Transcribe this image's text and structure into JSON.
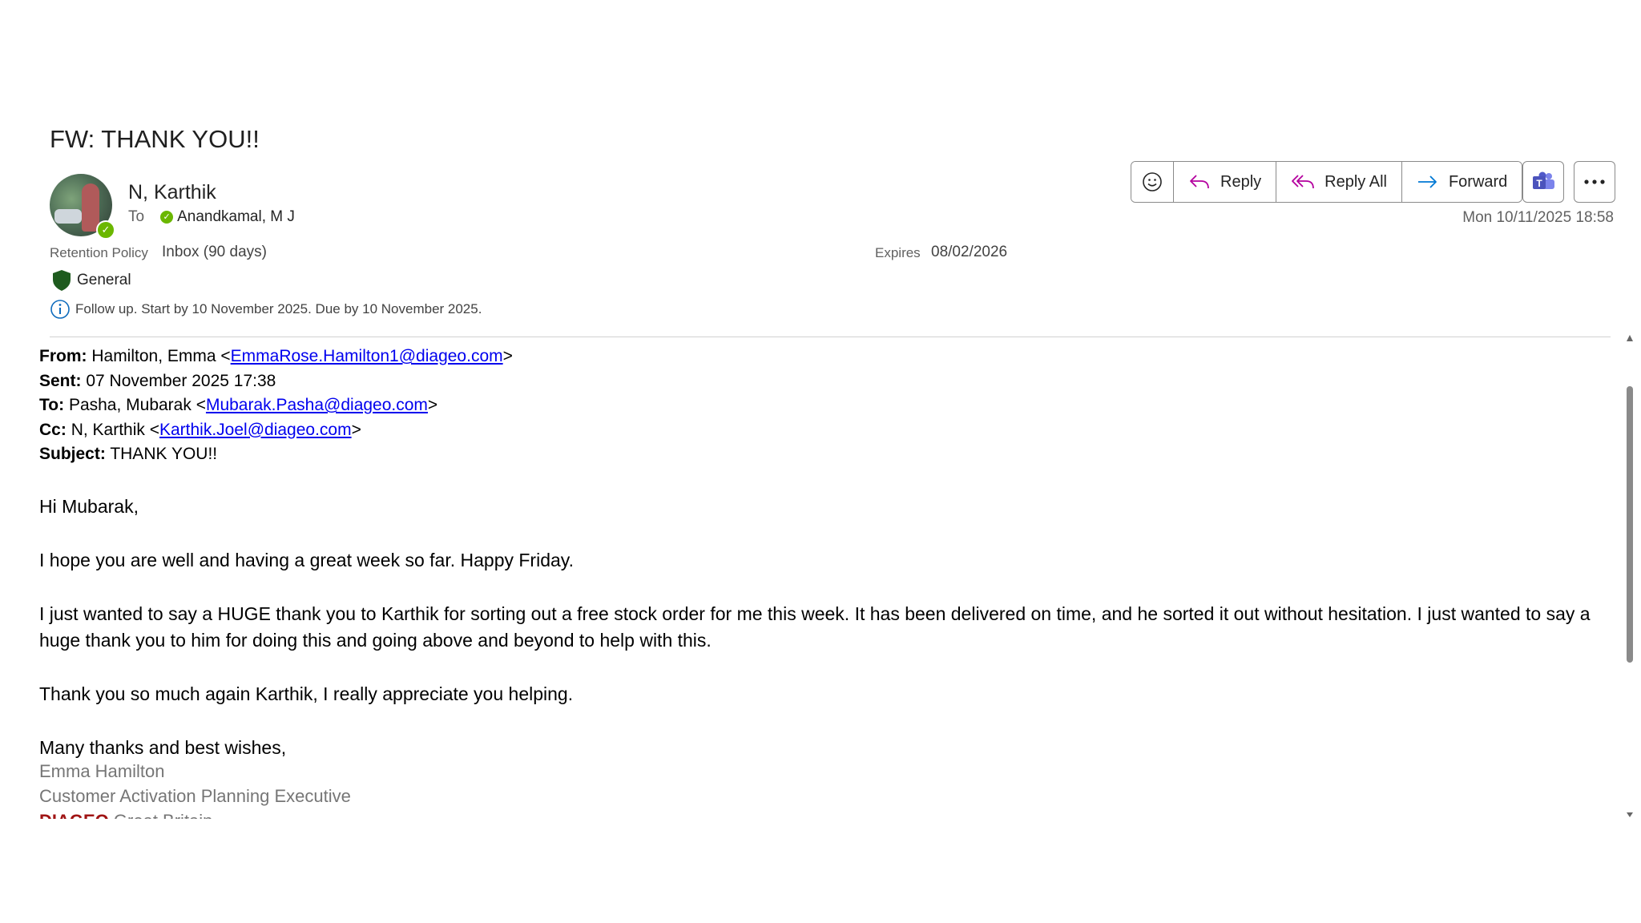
{
  "message": {
    "subject": "FW: THANK YOU!!",
    "sender": "N, Karthik",
    "to_label": "To",
    "recipient": "Anandkamal, M J",
    "date": "Mon 10/11/2025 18:58"
  },
  "retention": {
    "label": "Retention Policy",
    "value": "Inbox (90 days)",
    "expires_label": "Expires",
    "expires_value": "08/02/2026"
  },
  "sensitivity": {
    "label": "General"
  },
  "follow_up": {
    "text": "Follow up.  Start by 10 November 2025.  Due by 10 November 2025."
  },
  "toolbar": {
    "reply": "Reply",
    "reply_all": "Reply All",
    "forward": "Forward",
    "icons": [
      "smiley-icon",
      "reply-icon",
      "reply-all-icon",
      "forward-icon",
      "teams-icon",
      "more-icon"
    ]
  },
  "forwarded": {
    "from_label": "From:",
    "from_name": "Hamilton, Emma <",
    "from_email": "EmmaRose.Hamilton1@diageo.com",
    "sent_label": "Sent:",
    "sent_value": "07 November 2025 17:38",
    "to_label": "To:",
    "to_name": "Pasha, Mubarak <",
    "to_email": "Mubarak.Pasha@diageo.com",
    "cc_label": "Cc:",
    "cc_name": "N, Karthik <",
    "cc_email": "Karthik.Joel@diageo.com",
    "subject_label": "Subject:",
    "subject_value": "THANK YOU!!",
    "close_bracket": ">"
  },
  "body": {
    "greeting": "Hi Mubarak,",
    "p1": "I hope you are well and having a great week so far. Happy Friday.",
    "p2": "I just wanted to say a HUGE thank you to Karthik for sorting out a free stock order for me this week. It has been delivered on time, and he sorted it out without hesitation. I just wanted to say a huge thank you to him for doing this and going above and beyond to help with this.",
    "p3": "Thank you so much again Karthik, I really appreciate you helping.",
    "closing": "Many thanks and best wishes,",
    "sig_name": "Emma Hamilton",
    "sig_title": "Customer Activation Planning Executive",
    "sig_company": "DIAGEO",
    "sig_region": "Great Britain"
  },
  "colors": {
    "presence_available": "#6bb700",
    "reply_accent": "#b4009e",
    "forward_accent": "#0078d4",
    "shield": "#1e5b1e",
    "info": "#0f6cbd",
    "link": "#0000ee",
    "diageo_red": "#a01414"
  }
}
